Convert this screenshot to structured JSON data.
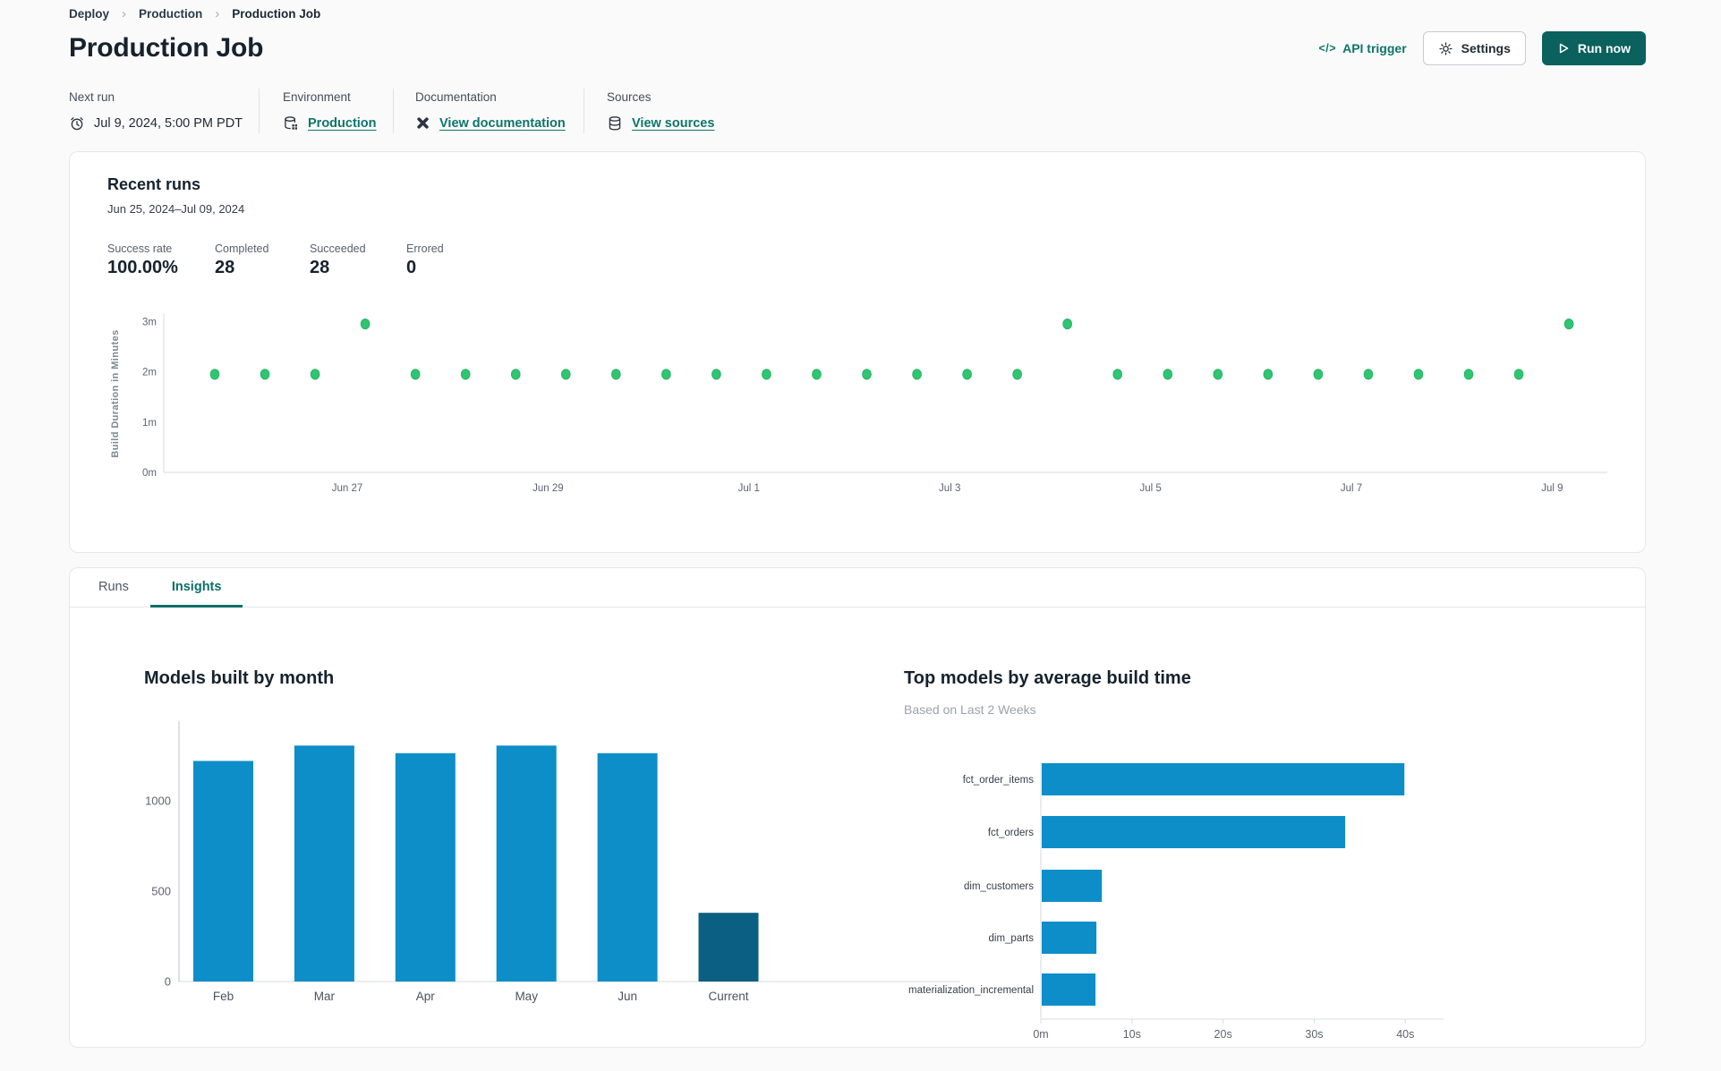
{
  "breadcrumb": {
    "items": [
      "Deploy",
      "Production",
      "Production Job"
    ]
  },
  "header": {
    "title": "Production Job",
    "api_trigger_label": "API trigger",
    "api_trigger_glyph": "</>",
    "settings_label": "Settings",
    "run_now_label": "Run now"
  },
  "meta": {
    "next_run": {
      "label": "Next run",
      "value": "Jul 9, 2024, 5:00 PM PDT"
    },
    "environment": {
      "label": "Environment",
      "value": "Production"
    },
    "documentation": {
      "label": "Documentation",
      "value": "View documentation"
    },
    "sources": {
      "label": "Sources",
      "value": "View sources"
    }
  },
  "recent_runs": {
    "title": "Recent runs",
    "date_range": "Jun 25, 2024–Jul 09, 2024",
    "stats": [
      {
        "label": "Success rate",
        "value": "100.00%"
      },
      {
        "label": "Completed",
        "value": "28"
      },
      {
        "label": "Succeeded",
        "value": "28"
      },
      {
        "label": "Errored",
        "value": "0"
      }
    ]
  },
  "tabs": [
    {
      "label": "Runs",
      "active": false
    },
    {
      "label": "Insights",
      "active": true
    }
  ],
  "colors": {
    "teal_link": "#0e756b",
    "teal_button": "#0a615d",
    "dot_green": "#2fc571",
    "bar_blue": "#0d8ec8",
    "bar_dark_blue": "#0b5f83",
    "axis_gray": "#d7dbe0"
  },
  "chart_data": [
    {
      "type": "scatter",
      "name": "run-duration-scatter",
      "ylabel": "Build Duration in Minutes",
      "y_ticks": [
        "0m",
        "1m",
        "2m",
        "3m"
      ],
      "ylim": [
        0,
        3.2
      ],
      "x_ticks": [
        "Jun 27",
        "Jun 29",
        "Jul 1",
        "Jul 3",
        "Jul 5",
        "Jul 7",
        "Jul 9"
      ],
      "values_minutes": [
        1.95,
        1.95,
        1.95,
        2.95,
        1.95,
        1.95,
        1.95,
        1.95,
        1.95,
        1.95,
        1.95,
        1.95,
        1.95,
        1.95,
        1.95,
        1.95,
        1.95,
        2.95,
        1.95,
        1.95,
        1.95,
        1.95,
        1.95,
        1.95,
        1.95,
        1.95,
        1.95,
        2.95
      ],
      "point_color": "#2fc571",
      "grid": false,
      "legend": "none"
    },
    {
      "type": "bar",
      "name": "models-built-by-month",
      "title": "Models built by month",
      "categories": [
        "Feb",
        "Mar",
        "Apr",
        "May",
        "Jun",
        "Current"
      ],
      "values": [
        1220,
        1305,
        1263,
        1305,
        1263,
        380
      ],
      "bar_colors": [
        "#0d8ec8",
        "#0d8ec8",
        "#0d8ec8",
        "#0d8ec8",
        "#0d8ec8",
        "#0b5f83"
      ],
      "y_ticks": [
        0,
        500,
        1000
      ],
      "ylim": [
        0,
        1440
      ],
      "xlabel": "",
      "ylabel": "",
      "grid": false,
      "legend": "none"
    },
    {
      "type": "hbar",
      "name": "top-models-by-avg-build-time",
      "title": "Top models by average build time",
      "subtitle": "Based on Last 2 Weeks",
      "categories": [
        "fct_order_items",
        "fct_orders",
        "dim_customers",
        "dim_parts",
        "materialization_incremental"
      ],
      "values_seconds": [
        39.8,
        33.3,
        6.6,
        6.0,
        5.9
      ],
      "x_ticks": [
        "0m",
        "10s",
        "20s",
        "30s",
        "40s"
      ],
      "x_tick_values": [
        0,
        10,
        20,
        30,
        40
      ],
      "xlim": [
        0,
        44
      ],
      "bar_color": "#0d8ec8",
      "grid": false,
      "legend": "none"
    }
  ]
}
